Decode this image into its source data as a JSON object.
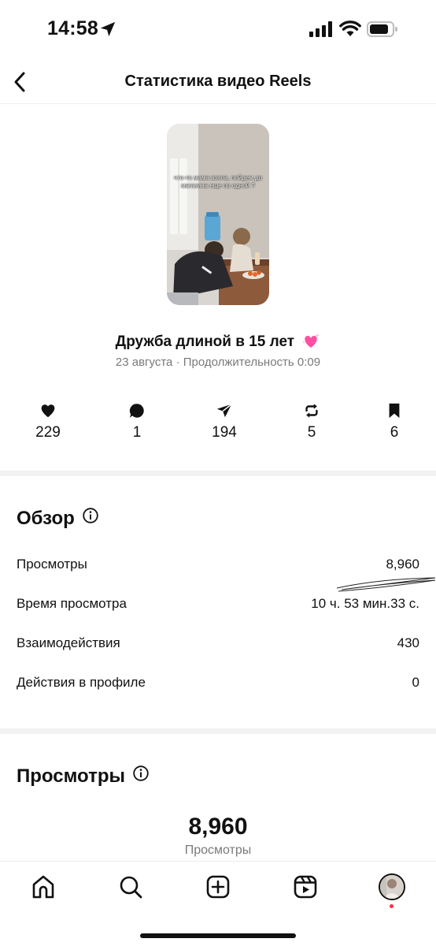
{
  "status_bar": {
    "time": "14:58",
    "icons": [
      "location-arrow-icon",
      "cellular-signal-icon",
      "wifi-icon",
      "battery-icon"
    ]
  },
  "header": {
    "title": "Статистика видео Reels",
    "back_icon": "chevron-left-icon"
  },
  "reel": {
    "thumbnail_caption": "что-то мама взяла, пойдем до магазина еще по одной ?",
    "title": "Дружба длиной в 15 лет",
    "title_emoji": "sparkling-heart-emoji",
    "meta": "23 августа · Продолжительность 0:09"
  },
  "metrics": [
    {
      "icon": "heart-icon",
      "value": "229"
    },
    {
      "icon": "comment-icon",
      "value": "1"
    },
    {
      "icon": "share-icon",
      "value": "194"
    },
    {
      "icon": "repost-icon",
      "value": "5"
    },
    {
      "icon": "bookmark-icon",
      "value": "6"
    }
  ],
  "overview": {
    "title": "Обзор",
    "rows": [
      {
        "label": "Просмотры",
        "value": "8,960"
      },
      {
        "label": "Время просмотра",
        "value": "10 ч. 53 мин.33 с."
      },
      {
        "label": "Взаимодействия",
        "value": "430"
      },
      {
        "label": "Действия в профиле",
        "value": "0"
      }
    ]
  },
  "views_section": {
    "title": "Просмотры",
    "number": "8,960",
    "label": "Просмотры"
  },
  "tab_bar": {
    "tabs": [
      "home-icon",
      "search-icon",
      "create-icon",
      "reels-icon",
      "profile-avatar"
    ]
  },
  "colors": {
    "accent_pink": "#ff4fa3",
    "muted_text": "#7a7a7a",
    "divider": "#f2f2f2",
    "notification_dot": "#ff2d46"
  }
}
